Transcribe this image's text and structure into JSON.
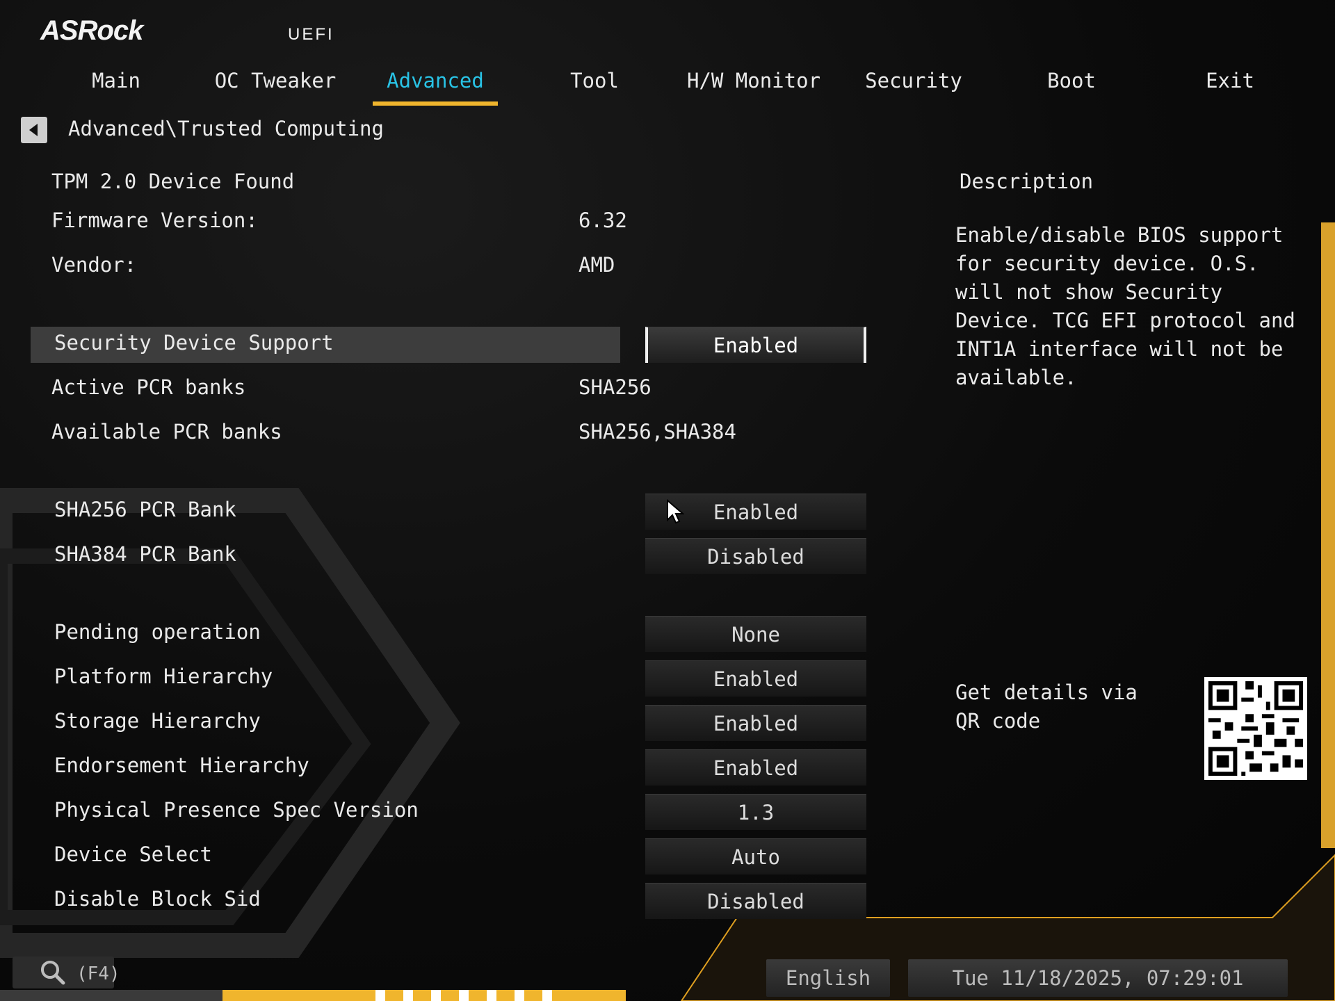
{
  "brand": {
    "logo": "ASRock",
    "subtitle": "UEFI"
  },
  "nav": {
    "tabs": [
      {
        "label": "Main"
      },
      {
        "label": "OC Tweaker"
      },
      {
        "label": "Advanced"
      },
      {
        "label": "Tool"
      },
      {
        "label": "H/W Monitor"
      },
      {
        "label": "Security"
      },
      {
        "label": "Boot"
      },
      {
        "label": "Exit"
      }
    ],
    "active_tab": "Advanced"
  },
  "breadcrumb": {
    "path": "Advanced\\Trusted Computing"
  },
  "info": {
    "device_found": "TPM 2.0 Device Found",
    "firmware_label": "Firmware Version:",
    "firmware_value": "6.32",
    "vendor_label": "Vendor:",
    "vendor_value": "AMD"
  },
  "settings": {
    "security_device_support": {
      "label": "Security Device Support",
      "value": "Enabled"
    },
    "active_pcr": {
      "label": "Active PCR banks",
      "value": "SHA256"
    },
    "available_pcr": {
      "label": "Available PCR banks",
      "value": "SHA256,SHA384"
    },
    "sha256_bank": {
      "label": "SHA256 PCR Bank",
      "value": "Enabled"
    },
    "sha384_bank": {
      "label": "SHA384 PCR Bank",
      "value": "Disabled"
    },
    "pending_operation": {
      "label": "Pending operation",
      "value": "None"
    },
    "platform_hierarchy": {
      "label": "Platform Hierarchy",
      "value": "Enabled"
    },
    "storage_hierarchy": {
      "label": "Storage Hierarchy",
      "value": "Enabled"
    },
    "endorsement_hierarchy": {
      "label": "Endorsement Hierarchy",
      "value": "Enabled"
    },
    "pp_spec_version": {
      "label": "Physical Presence Spec Version",
      "value": "1.3"
    },
    "device_select": {
      "label": "Device Select",
      "value": "Auto"
    },
    "disable_block_sid": {
      "label": "Disable Block Sid",
      "value": "Disabled"
    }
  },
  "description": {
    "title": "Description",
    "text": "Enable/disable BIOS support for security device. O.S. will not show Security Device. TCG EFI protocol and INT1A interface will not be available.",
    "qr_text": "Get details via QR code"
  },
  "footer": {
    "search_label": "(F4)",
    "language": "English",
    "datetime": "Tue 11/18/2025, 07:29:01"
  },
  "colors": {
    "accent_cyan": "#29c3e6",
    "accent_yellow": "#f0b52d",
    "highlight_row": "#3d3d3d"
  },
  "icons": [
    "back-arrow-icon",
    "search-icon",
    "qr-code-icon",
    "mouse-cursor-icon"
  ]
}
